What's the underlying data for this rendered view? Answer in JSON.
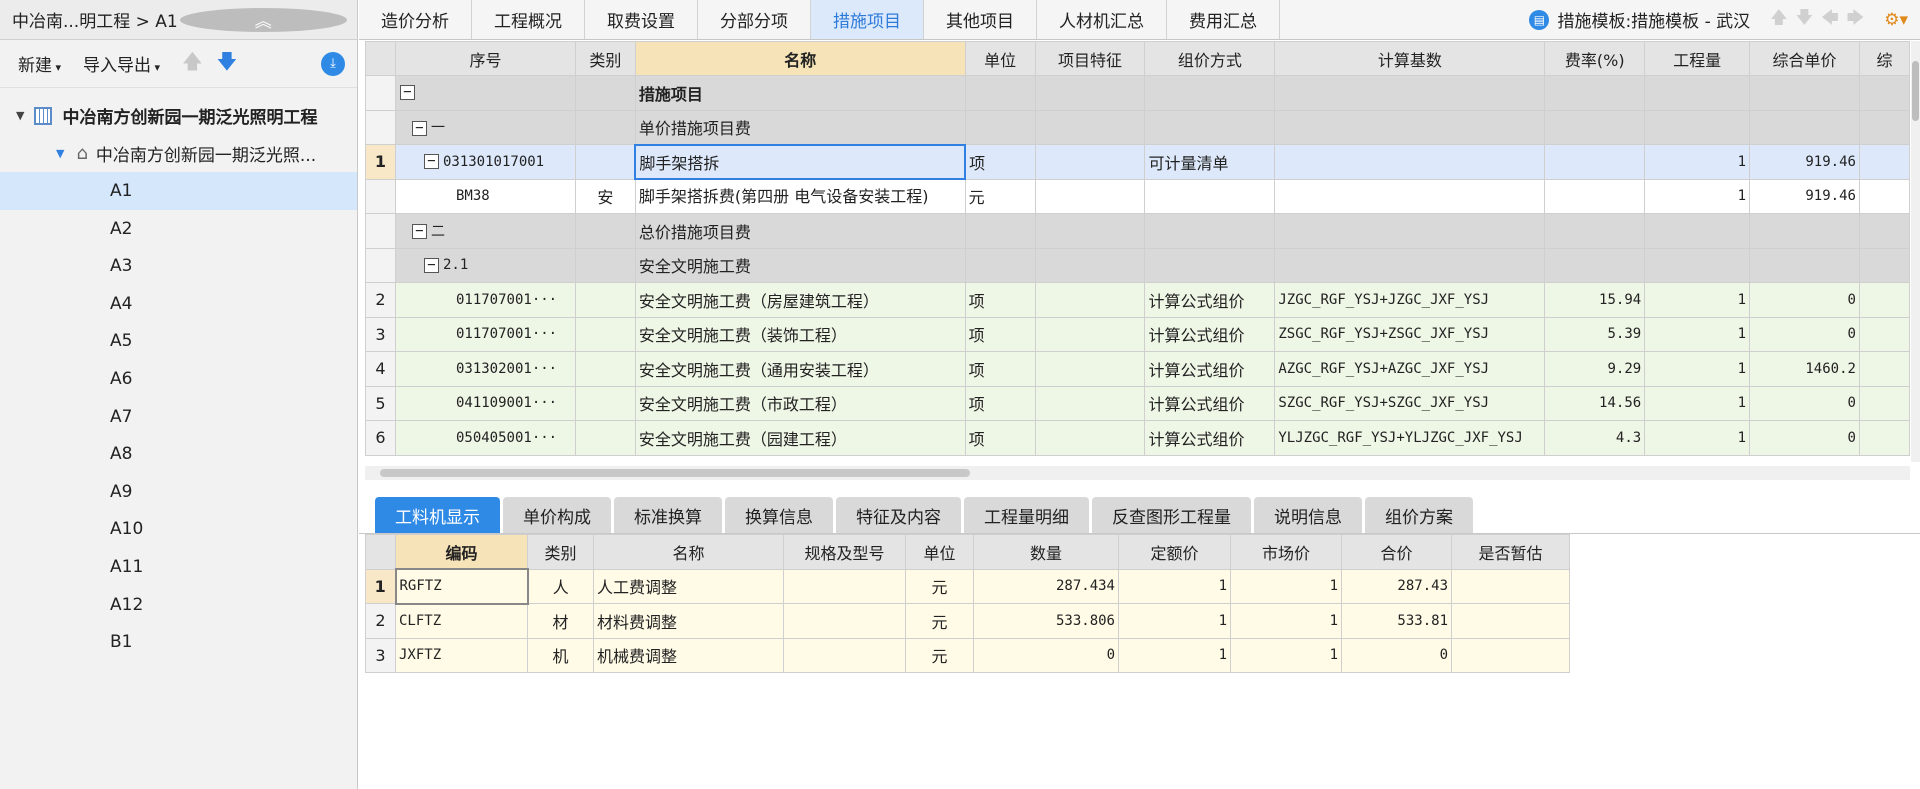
{
  "left": {
    "title": "中冶南...明工程 > A1",
    "collapse_icon": "double-chevron-up-icon",
    "new_label": "新建",
    "import_label": "导入导出",
    "tree": {
      "project": "中冶南方创新园一期泛光照明工程",
      "unit": "中冶南方创新园一期泛光照...",
      "items": [
        "A1",
        "A2",
        "A3",
        "A4",
        "A5",
        "A6",
        "A7",
        "A8",
        "A9",
        "A10",
        "A11",
        "A12",
        "B1"
      ],
      "selected": "A1"
    }
  },
  "tabs": [
    "造价分析",
    "工程概况",
    "取费设置",
    "分部分项",
    "措施项目",
    "其他项目",
    "人材机汇总",
    "费用汇总"
  ],
  "active_tab": "措施项目",
  "template_label": "措施模板:措施模板 - 武汉",
  "grid": {
    "headers": [
      "序号",
      "类别",
      "名称",
      "单位",
      "项目特征",
      "组价方式",
      "计算基数",
      "费率(%)",
      "工程量",
      "综合单价",
      "综"
    ],
    "rows": [
      {
        "no": "",
        "code": "",
        "type": "",
        "name": "措施项目",
        "unit": "",
        "feature": "",
        "method": "",
        "base": "",
        "rate": "",
        "qty": "",
        "price": ""
      },
      {
        "no": "",
        "code": "一",
        "type": "",
        "name": "单价措施项目费",
        "unit": "",
        "feature": "",
        "method": "",
        "base": "",
        "rate": "",
        "qty": "",
        "price": ""
      },
      {
        "no": "1",
        "code": "031301017001",
        "type": "",
        "name": "脚手架搭拆",
        "unit": "项",
        "feature": "",
        "method": "可计量清单",
        "base": "",
        "rate": "",
        "qty": "1",
        "price": "919.46"
      },
      {
        "no": "",
        "code": "BM38",
        "type": "安",
        "name": "脚手架搭拆费(第四册 电气设备安装工程)",
        "unit": "元",
        "feature": "",
        "method": "",
        "base": "",
        "rate": "",
        "qty": "1",
        "price": "919.46"
      },
      {
        "no": "",
        "code": "二",
        "type": "",
        "name": "总价措施项目费",
        "unit": "",
        "feature": "",
        "method": "",
        "base": "",
        "rate": "",
        "qty": "",
        "price": ""
      },
      {
        "no": "",
        "code": "2.1",
        "type": "",
        "name": "安全文明施工费",
        "unit": "",
        "feature": "",
        "method": "",
        "base": "",
        "rate": "",
        "qty": "",
        "price": ""
      },
      {
        "no": "2",
        "code": "011707001···",
        "type": "",
        "name": "安全文明施工费（房屋建筑工程）",
        "unit": "项",
        "feature": "",
        "method": "计算公式组价",
        "base": "JZGC_RGF_YSJ+JZGC_JXF_YSJ",
        "rate": "15.94",
        "qty": "1",
        "price": "0"
      },
      {
        "no": "3",
        "code": "011707001···",
        "type": "",
        "name": "安全文明施工费（装饰工程）",
        "unit": "项",
        "feature": "",
        "method": "计算公式组价",
        "base": "ZSGC_RGF_YSJ+ZSGC_JXF_YSJ",
        "rate": "5.39",
        "qty": "1",
        "price": "0"
      },
      {
        "no": "4",
        "code": "031302001···",
        "type": "",
        "name": "安全文明施工费（通用安装工程）",
        "unit": "项",
        "feature": "",
        "method": "计算公式组价",
        "base": "AZGC_RGF_YSJ+AZGC_JXF_YSJ",
        "rate": "9.29",
        "qty": "1",
        "price": "1460.2"
      },
      {
        "no": "5",
        "code": "041109001···",
        "type": "",
        "name": "安全文明施工费（市政工程）",
        "unit": "项",
        "feature": "",
        "method": "计算公式组价",
        "base": "SZGC_RGF_YSJ+SZGC_JXF_YSJ",
        "rate": "14.56",
        "qty": "1",
        "price": "0"
      },
      {
        "no": "6",
        "code": "050405001···",
        "type": "",
        "name": "安全文明施工费（园建工程）",
        "unit": "项",
        "feature": "",
        "method": "计算公式组价",
        "base": "YLJZGC_RGF_YSJ+YLJZGC_JXF_YSJ",
        "rate": "4.3",
        "qty": "1",
        "price": "0"
      }
    ]
  },
  "bottom_tabs": [
    "工料机显示",
    "单价构成",
    "标准换算",
    "换算信息",
    "特征及内容",
    "工程量明细",
    "反查图形工程量",
    "说明信息",
    "组价方案"
  ],
  "active_bottom_tab": "工料机显示",
  "grid2": {
    "headers": [
      "编码",
      "类别",
      "名称",
      "规格及型号",
      "单位",
      "数量",
      "定额价",
      "市场价",
      "合价",
      "是否暂估"
    ],
    "rows": [
      {
        "no": "1",
        "code": "RGFTZ",
        "type": "人",
        "name": "人工费调整",
        "spec": "",
        "unit": "元",
        "qty": "287.434",
        "quota": "1",
        "market": "1",
        "total": "287.43",
        "est": ""
      },
      {
        "no": "2",
        "code": "CLFTZ",
        "type": "材",
        "name": "材料费调整",
        "spec": "",
        "unit": "元",
        "qty": "533.806",
        "quota": "1",
        "market": "1",
        "total": "533.81",
        "est": ""
      },
      {
        "no": "3",
        "code": "JXFTZ",
        "type": "机",
        "name": "机械费调整",
        "spec": "",
        "unit": "元",
        "qty": "0",
        "quota": "1",
        "market": "1",
        "total": "0",
        "est": ""
      }
    ]
  }
}
